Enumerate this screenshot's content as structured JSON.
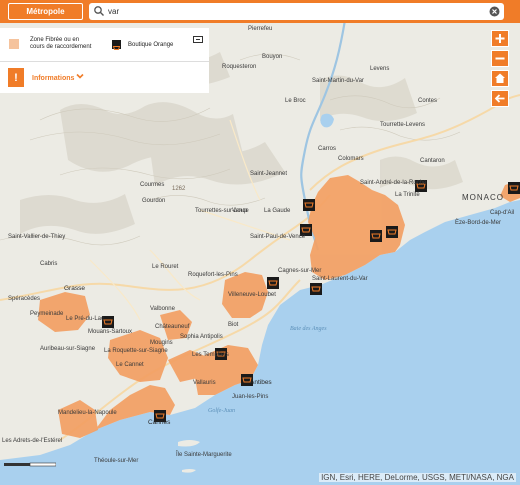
{
  "header": {
    "region_button": "Métropole",
    "search_value": "var"
  },
  "legend": {
    "fiber_zone_label": "Zone Fibrée ou en cours de raccordement",
    "shop_label": "Boutique Orange",
    "info_label": "Informations",
    "info_badge": "!"
  },
  "colors": {
    "accent": "#f07c28",
    "fiber_zone": "#f3a064",
    "sea": "#a9d0ee",
    "land": "#eceae3",
    "shop_icon": "#1a1a1a"
  },
  "map_controls": [
    "zoom-in",
    "zoom-out",
    "home",
    "back"
  ],
  "attribution": "IGN, Esri, HERE, DeLorme, USGS, METI/NASA, NGA",
  "scale": {
    "label": "0    5"
  },
  "places": {
    "pierrefeu": "Pierrefeu",
    "bouyon": "Bouyon",
    "roquesteron": "Roquesteron",
    "st_martin_du_var": "Saint-Martin-du-Var",
    "levens": "Levens",
    "contes": "Contes",
    "le_broc": "Le Broc",
    "tourrette_levens": "Tourrette-Levens",
    "carros": "Carros",
    "colomars": "Colomars",
    "cantaron": "Cantaron",
    "st_jeannet": "Saint-Jeannet",
    "st_andre": "Saint-André-de-la-Roche",
    "la_trinite": "La Trinité",
    "monaco": "MONACO",
    "eze_bord_de_mer": "Èze-Bord-de-Mer",
    "cap_dail": "Cap-d'Ail",
    "courmes": "Courmes",
    "gourdon": "Gourdon",
    "tourrettes_sur_loup": "Tourrettes-sur-Loup",
    "vence": "Vence",
    "la_gaude": "La Gaude",
    "st_laurent_du_var": "Saint-Laurent-du-Var",
    "nice": "Nice",
    "st_paul_de_vence": "Saint-Paul-de-Vence",
    "st_vallier": "Saint-Vallier-de-Thiey",
    "cabris": "Cabris",
    "le_rouret": "Le Rouret",
    "roquefort": "Roquefort-les-Pins",
    "villeneuve_loubet": "Villeneuve-Loubet",
    "cagnes": "Cagnes-sur-Mer",
    "spéracèdes": "Spéracèdes",
    "grasse": "Grasse",
    "peymeinade": "Peymeinade",
    "valbonne": "Valbonne",
    "opio": "Opio",
    "chateauneuf": "Châteauneuf",
    "biot": "Biot",
    "baie_des_anges": "Baie des Anges",
    "mouans_sartoux": "Mouans-Sartoux",
    "la_roquette": "La Roquette-sur-Siagne",
    "mougins": "Mougins",
    "auribeau": "Auribeau-sur-Siagne",
    "antibes": "Antibes",
    "vallauris": "Vallauris",
    "juan_les_pins": "Juan-les-Pins",
    "mandelieu": "Mandelieu-la-Napoule",
    "cannes": "Cannes",
    "golfe_juan": "Golfe-Juan",
    "theoule": "Théoule-sur-Mer",
    "adrets": "Les Adrets-de-l'Estérel",
    "ste_marguerite": "Île Sainte-Marguerite",
    "alt_1262": "1262",
    "le_cannet": "Le Cannet",
    "sophia": "Sophia Antipolis",
    "les_templiers": "Les Templiers",
    "pre_du_lac": "Le Pré-du-Lac"
  }
}
